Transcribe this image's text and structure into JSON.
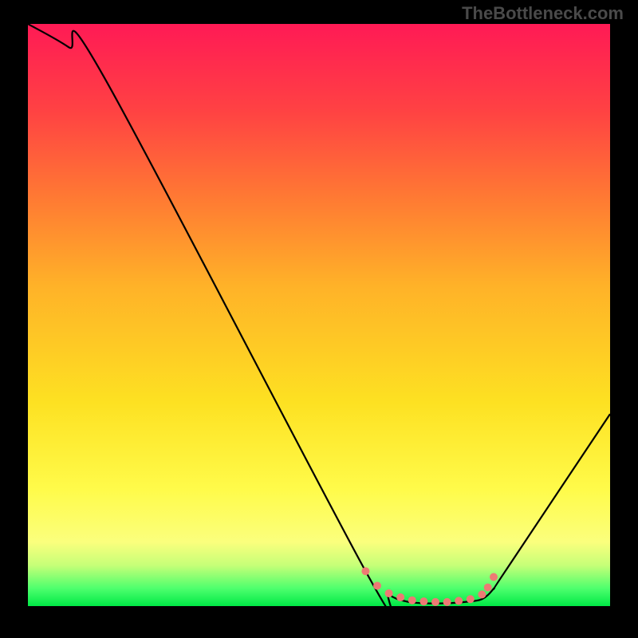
{
  "watermark": "TheBottleneck.com",
  "chart_data": {
    "type": "line",
    "title": "",
    "xlabel": "",
    "ylabel": "",
    "xlim": [
      0,
      100
    ],
    "ylim": [
      0,
      100
    ],
    "series": [
      {
        "name": "bottleneck-curve",
        "x": [
          0,
          7,
          13,
          58,
          62,
          65,
          68,
          72,
          75,
          78,
          80,
          82,
          100
        ],
        "values": [
          100,
          96,
          91,
          6,
          2,
          0.8,
          0.5,
          0.5,
          0.7,
          1.2,
          3,
          6,
          33
        ]
      }
    ],
    "markers": {
      "name": "optimal-range",
      "color": "#ed7a74",
      "x": [
        58,
        60,
        62,
        64,
        66,
        68,
        70,
        72,
        74,
        76,
        78,
        79,
        80
      ],
      "values": [
        6,
        3.5,
        2.2,
        1.5,
        1.0,
        0.8,
        0.7,
        0.7,
        0.9,
        1.2,
        2.0,
        3.2,
        5.0
      ]
    }
  }
}
